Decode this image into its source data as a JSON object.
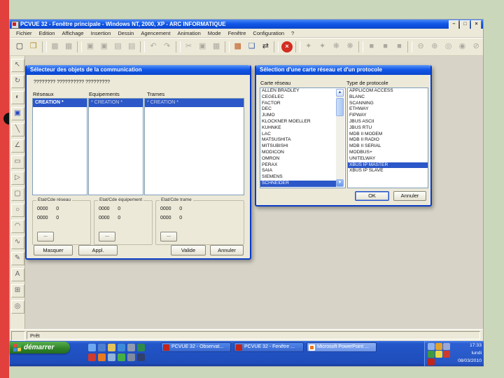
{
  "slide": {
    "bg_color": "#cbd7ba",
    "accent_bar_color": "#e2403c"
  },
  "window": {
    "title": "PCVUE 32  -  Fenêtre principale  -  Windows NT, 2000, XP  -  ARC INFORMATIQUE",
    "menu": [
      "Fichier",
      "Edition",
      "Affichage",
      "Insertion",
      "Dessin",
      "Agencement",
      "Animation",
      "Mode",
      "Fenêtre",
      "Configuration",
      "?"
    ],
    "controls": [
      {
        "n": "minimize-button",
        "g": "–"
      },
      {
        "n": "maximize-button",
        "g": "□"
      },
      {
        "n": "close-button",
        "g": "×"
      }
    ],
    "status_text": "Prêt"
  },
  "toolbar": {
    "icons": [
      {
        "n": "new-file-icon",
        "g": "▢",
        "c": "#333"
      },
      {
        "n": "open-folder-icon",
        "g": "❒",
        "c": "#b08c28"
      },
      {
        "sep": true
      },
      {
        "n": "save-icon",
        "g": "▦",
        "d": true
      },
      {
        "n": "save-all-icon",
        "g": "▦",
        "d": true
      },
      {
        "sep": true
      },
      {
        "n": "export-icon",
        "g": "▣",
        "d": true
      },
      {
        "n": "import-icon",
        "g": "▣",
        "d": true
      },
      {
        "n": "page-setup-icon",
        "g": "▤",
        "d": true
      },
      {
        "n": "print-icon",
        "g": "▤",
        "d": true
      },
      {
        "sep": true
      },
      {
        "n": "undo-icon",
        "g": "↶",
        "d": true
      },
      {
        "n": "redo-icon",
        "g": "↷",
        "d": true
      },
      {
        "sep": true
      },
      {
        "n": "cut-icon",
        "g": "✂",
        "d": true
      },
      {
        "n": "copy-icon",
        "g": "▣",
        "d": true
      },
      {
        "n": "paste-icon",
        "g": "▦",
        "d": true
      },
      {
        "sep": true
      },
      {
        "n": "workspace-icon",
        "g": "▩",
        "c": "#c05a1e"
      },
      {
        "n": "new-window-icon",
        "g": "❏",
        "c": "#3a5fae"
      },
      {
        "n": "switch-window-icon",
        "g": "⇄",
        "c": "#333"
      },
      {
        "sep": true
      },
      {
        "n": "stop-icon",
        "g": "×",
        "b": "#d42c20"
      },
      {
        "sep": true
      },
      {
        "n": "run-mode-icon",
        "g": "✦",
        "d": true
      },
      {
        "n": "run-all-icon",
        "g": "✦",
        "d": true
      },
      {
        "n": "animation-on-icon",
        "g": "❋",
        "d": true
      },
      {
        "n": "animation-off-icon",
        "g": "❋",
        "d": true
      },
      {
        "sep": true
      },
      {
        "n": "fill-icon",
        "g": "■",
        "d": true
      },
      {
        "n": "fill2-icon",
        "g": "■",
        "d": true
      },
      {
        "n": "fill3-icon",
        "g": "■",
        "d": true
      },
      {
        "sep": true
      },
      {
        "n": "zoom-out-icon",
        "g": "⊖",
        "d": true
      },
      {
        "n": "zoom-in-icon",
        "g": "⊕",
        "d": true
      },
      {
        "n": "zoom-sel-icon",
        "g": "◎",
        "d": true
      },
      {
        "n": "zoom-fit-icon",
        "g": "◉",
        "d": true
      },
      {
        "n": "zoom-cancel-icon",
        "g": "⊘",
        "d": true
      }
    ]
  },
  "toolbox": {
    "icons": [
      {
        "n": "select-tool-icon",
        "g": "↖"
      },
      {
        "n": "rotate-tool-icon",
        "g": "↻",
        "d": true
      },
      {
        "n": "info-tool-icon",
        "g": "◐"
      },
      {
        "n": "image-tool-icon",
        "g": "▣",
        "c": "#2a48c0"
      },
      {
        "n": "line-tool-icon",
        "g": "╲"
      },
      {
        "n": "polyline-tool-icon",
        "g": "∠"
      },
      {
        "n": "rect-tool-icon",
        "g": "▭"
      },
      {
        "n": "polygon-tool-icon",
        "g": "▷"
      },
      {
        "n": "roundrect-tool-icon",
        "g": "▢"
      },
      {
        "n": "ellipse-tool-icon",
        "g": "○"
      },
      {
        "n": "arc-tool-icon",
        "g": "◠"
      },
      {
        "n": "curve-tool-icon",
        "g": "∿"
      },
      {
        "n": "freehand-tool-icon",
        "g": "✎"
      },
      {
        "n": "text-tool-icon",
        "g": "A"
      },
      {
        "n": "grid-tool-icon",
        "g": "⊞"
      },
      {
        "n": "zoom-tool-icon",
        "g": "◎"
      }
    ]
  },
  "dialog_selector": {
    "title": "Sélecteur des objets de la communication",
    "hint": "???????? ?????????? ?????????",
    "col_networks": {
      "label": "Réseaux",
      "selected_item": "CREATION *"
    },
    "col_equipments": {
      "label": "Equipements",
      "selected_item": "* CREATION *"
    },
    "col_frames": {
      "label": "Trames",
      "selected_item": "* CREATION *"
    },
    "groups": [
      {
        "label": "Etat/Cde réseau",
        "rows": [
          "0000      0",
          "0000      0"
        ],
        "more_label": "..."
      },
      {
        "label": "Etat/Cde équipement",
        "rows": [
          "0000      0",
          "0000      0"
        ],
        "more_label": "..."
      },
      {
        "label": "Etat/Cde trame",
        "rows": [
          "0000      0",
          "0000      0"
        ],
        "more_label": "..."
      }
    ],
    "buttons": {
      "hide": "Masquer",
      "apply": "Appl.",
      "validate": "Valide",
      "cancel": "Annuler"
    }
  },
  "dialog_protocol": {
    "title": "Sélection d'une carte réseau et d'un protocole",
    "network_card": {
      "label": "Carte réseau",
      "items": [
        {
          "t": "ALLEN BRADLEY"
        },
        {
          "t": "CEGELEC"
        },
        {
          "t": "FACTOR"
        },
        {
          "t": "DEC"
        },
        {
          "t": "JUMO"
        },
        {
          "t": "KLOCKNER MOELLER"
        },
        {
          "t": "KUHNKE"
        },
        {
          "t": "LAC"
        },
        {
          "t": "MATSUSHITA"
        },
        {
          "t": "MITSUBISHI"
        },
        {
          "t": "MODICON"
        },
        {
          "t": "OMRON"
        },
        {
          "t": "PERAX"
        },
        {
          "t": "SAIA"
        },
        {
          "t": "SIEMENS"
        },
        {
          "t": "SCHNEIDER",
          "s": true
        }
      ]
    },
    "protocol": {
      "label": "Type de protocole",
      "items": [
        {
          "t": "APPLICOM ACCESS"
        },
        {
          "t": "BLANC"
        },
        {
          "t": "SCANNING"
        },
        {
          "t": "ETHWAY"
        },
        {
          "t": "FIPWAY"
        },
        {
          "t": "JBUS ASCII"
        },
        {
          "t": "JBUS RTU"
        },
        {
          "t": "MDB II MODEM"
        },
        {
          "t": "MDB II RADIO"
        },
        {
          "t": "MDB II SERIAL"
        },
        {
          "t": "MODBUS+"
        },
        {
          "t": "UNITELWAY"
        },
        {
          "t": "XBUS IP MASTER",
          "s": true
        },
        {
          "t": "XBUS IP SLAVE"
        }
      ]
    },
    "buttons": {
      "ok": "OK",
      "cancel": "Annuler"
    }
  },
  "taskbar": {
    "start_label": "démarrer",
    "quick_launch": [
      {
        "n": "ie-icon",
        "c": "#6fa8ef"
      },
      {
        "n": "messenger-icon",
        "c": "#4d7fd0"
      },
      {
        "n": "folder-icon",
        "c": "#e3c35a"
      },
      {
        "n": "browser-icon",
        "c": "#3f8ad8"
      },
      {
        "n": "show-desktop-icon",
        "c": "#8f9bb0"
      },
      {
        "n": "excel-icon",
        "c": "#2e8a4a"
      },
      {
        "n": "acrobat-icon",
        "c": "#d13a2e"
      },
      {
        "n": "firefox-icon",
        "c": "#e87a20"
      },
      {
        "n": "paint-icon",
        "c": "#8fb4d8"
      },
      {
        "n": "msn-icon",
        "c": "#44b044"
      },
      {
        "n": "print-icon",
        "c": "#7f8aa0"
      },
      {
        "n": "media-icon",
        "c": "#30406a"
      }
    ],
    "tasks": [
      {
        "label": "PCVUE 32 - Observat...",
        "active": false
      },
      {
        "label": "PCVUE 32 - Fenêtre ...",
        "active": false
      },
      {
        "label": "Microsoft PowerPoint ...",
        "active": true
      }
    ],
    "tray_icons": [
      {
        "n": "network-tray-icon",
        "c": "#8fb2e8"
      },
      {
        "n": "update-tray-icon",
        "c": "#e0a22c"
      },
      {
        "n": "volume-tray-icon",
        "c": "#9aa8d8"
      },
      {
        "n": "vpn-tray-icon",
        "c": "#3f9a3f"
      },
      {
        "n": "pcvue-tray-icon",
        "c": "#e8d84a"
      },
      {
        "n": "antivirus-tray-icon",
        "c": "#cf3a2e"
      },
      {
        "n": "security-tray-icon",
        "c": "#c22418"
      }
    ],
    "clock": {
      "time": "17:33",
      "day": "lundi",
      "date": "08/03/2010"
    }
  }
}
